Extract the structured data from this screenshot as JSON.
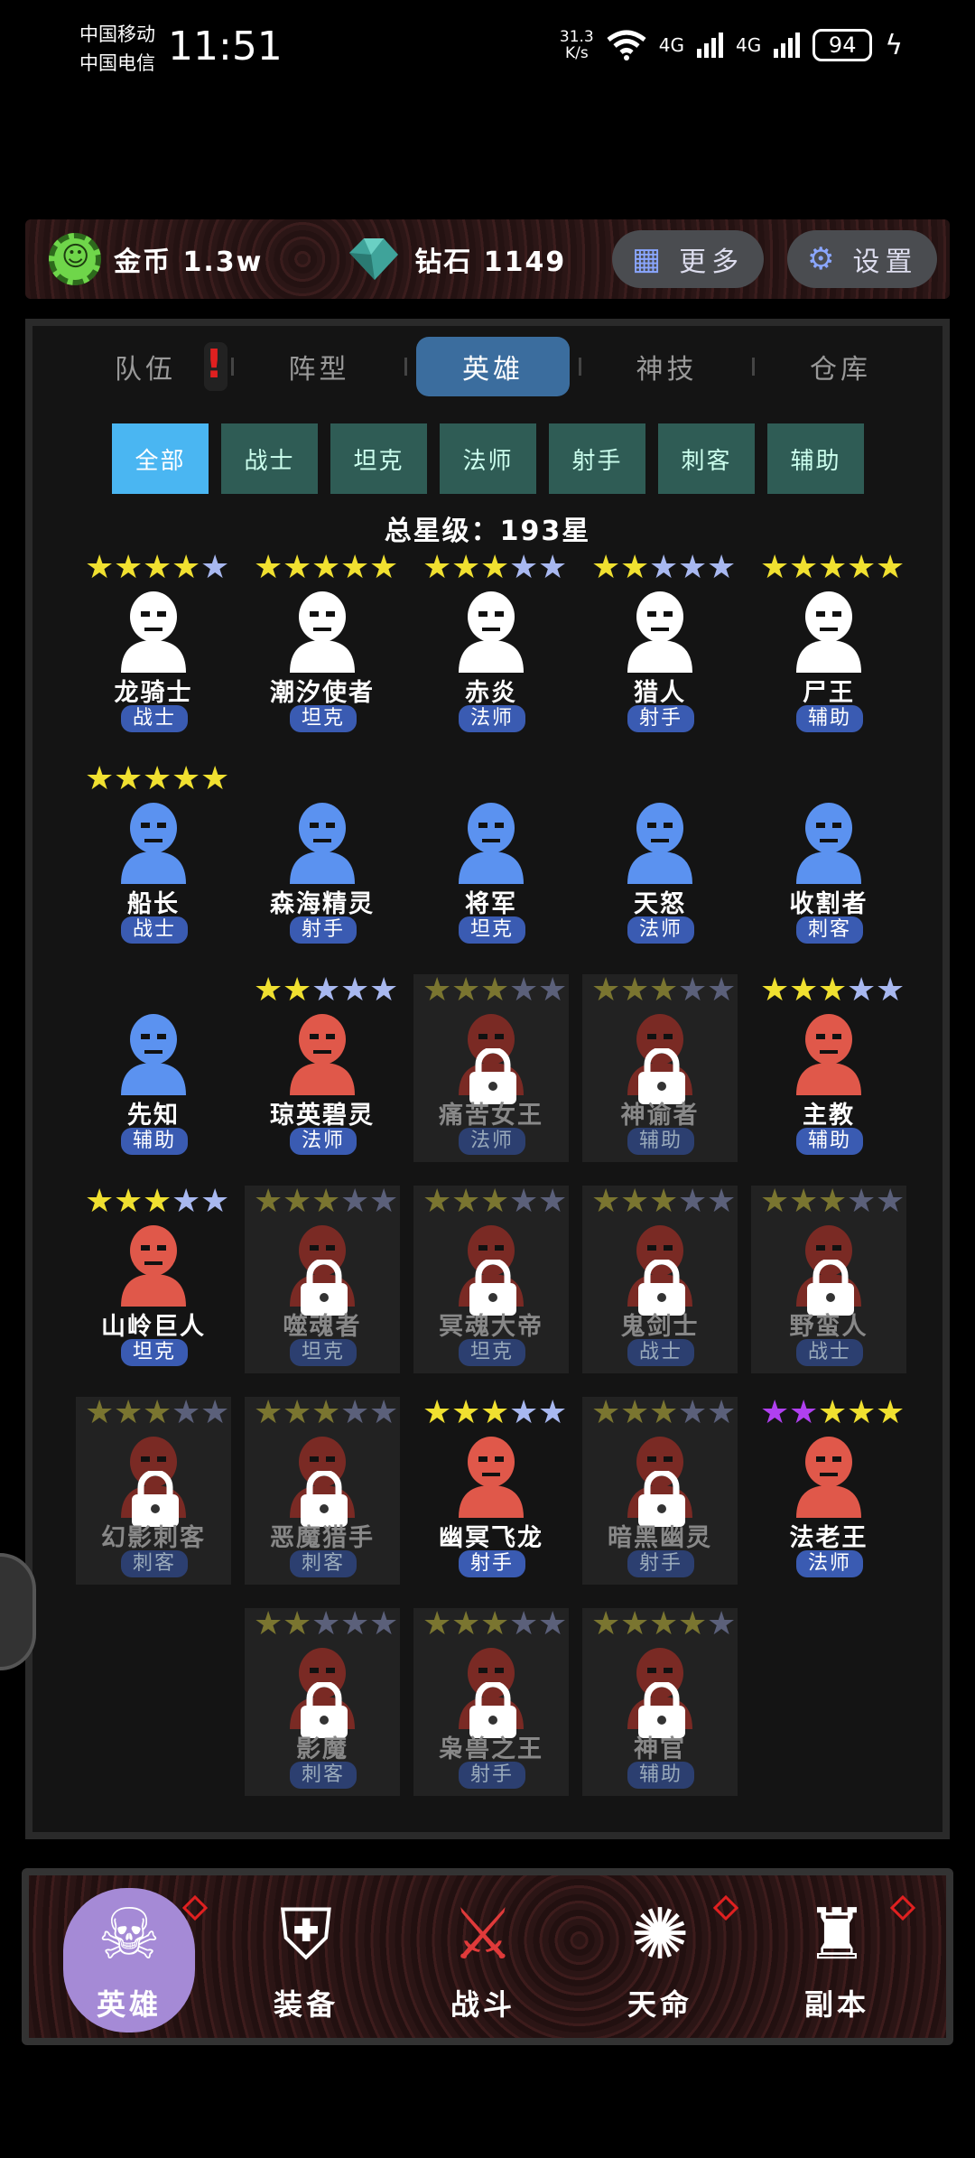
{
  "status": {
    "carrier1": "中国移动",
    "carrier2": "中国电信",
    "time": "11:51",
    "speed_top": "31.3",
    "speed_bottom": "K/s",
    "net1": "4G",
    "net2": "4G",
    "battery": "94"
  },
  "top": {
    "gold_label": "金币 1.3w",
    "diamond_label": "钻石 1149",
    "more": "更多",
    "settings": "设置"
  },
  "tabs": [
    "队伍",
    "阵型",
    "英雄",
    "神技",
    "仓库"
  ],
  "tab_alert": "!",
  "filters": [
    "全部",
    "战士",
    "坦克",
    "法师",
    "射手",
    "刺客",
    "辅助"
  ],
  "total": "总星级：193星",
  "heroes": [
    {
      "name": "龙骑士",
      "role": "战士",
      "stars": 4,
      "max": 5,
      "locked": false,
      "icon": "viking-helmet",
      "color": "#ffffff"
    },
    {
      "name": "潮汐使者",
      "role": "坦克",
      "stars": 5,
      "max": 5,
      "locked": false,
      "icon": "knight",
      "color": "#ffffff"
    },
    {
      "name": "赤炎",
      "role": "法师",
      "stars": 3,
      "max": 5,
      "locked": false,
      "icon": "demon-mask",
      "color": "#ffffff"
    },
    {
      "name": "猎人",
      "role": "射手",
      "stars": 2,
      "max": 5,
      "locked": false,
      "icon": "old-hunter",
      "color": "#ffffff"
    },
    {
      "name": "尸王",
      "role": "辅助",
      "stars": 5,
      "max": 5,
      "locked": false,
      "icon": "zombie",
      "color": "#ffffff"
    },
    {
      "name": "船长",
      "role": "战士",
      "stars": 5,
      "max": 5,
      "locked": false,
      "icon": "pirate",
      "color": "#5b92f0"
    },
    {
      "name": "森海精灵",
      "role": "射手",
      "stars": 0,
      "max": 0,
      "locked": false,
      "icon": "elf",
      "color": "#5b92f0"
    },
    {
      "name": "将军",
      "role": "坦克",
      "stars": 0,
      "max": 0,
      "locked": false,
      "icon": "helmet",
      "color": "#5b92f0"
    },
    {
      "name": "天怒",
      "role": "法师",
      "stars": 0,
      "max": 0,
      "locked": false,
      "icon": "druid",
      "color": "#5b92f0"
    },
    {
      "name": "收割者",
      "role": "刺客",
      "stars": 0,
      "max": 0,
      "locked": false,
      "icon": "reaper",
      "color": "#5b92f0"
    },
    {
      "name": "先知",
      "role": "辅助",
      "stars": 0,
      "max": 0,
      "locked": false,
      "icon": "prophet",
      "color": "#5b92f0"
    },
    {
      "name": "琼英碧灵",
      "role": "法师",
      "stars": 2,
      "max": 5,
      "locked": false,
      "icon": "voodoo",
      "color": "#e0584a"
    },
    {
      "name": "痛苦女王",
      "role": "法师",
      "stars": 3,
      "max": 5,
      "locked": true,
      "icon": "queen",
      "color": "#7a2a24"
    },
    {
      "name": "神谕者",
      "role": "辅助",
      "stars": 3,
      "max": 5,
      "locked": true,
      "icon": "oracle",
      "color": "#7a2a24"
    },
    {
      "name": "主教",
      "role": "辅助",
      "stars": 3,
      "max": 5,
      "locked": false,
      "icon": "bishop",
      "color": "#e0584a"
    },
    {
      "name": "山岭巨人",
      "role": "坦克",
      "stars": 3,
      "max": 5,
      "locked": false,
      "icon": "giant",
      "color": "#e0584a"
    },
    {
      "name": "噬魂者",
      "role": "坦克",
      "stars": 3,
      "max": 5,
      "locked": true,
      "icon": "tribal",
      "color": "#7a2a24"
    },
    {
      "name": "冥魂大帝",
      "role": "坦克",
      "stars": 3,
      "max": 5,
      "locked": true,
      "icon": "emperor",
      "color": "#7a2a24"
    },
    {
      "name": "鬼剑士",
      "role": "战士",
      "stars": 3,
      "max": 5,
      "locked": true,
      "icon": "swordsman",
      "color": "#7a2a24"
    },
    {
      "name": "野蛮人",
      "role": "战士",
      "stars": 3,
      "max": 5,
      "locked": true,
      "icon": "barbarian",
      "color": "#7a2a24"
    },
    {
      "name": "幻影刺客",
      "role": "刺客",
      "stars": 3,
      "max": 5,
      "locked": true,
      "icon": "phantom",
      "color": "#7a2a24"
    },
    {
      "name": "恶魔猎手",
      "role": "刺客",
      "stars": 3,
      "max": 5,
      "locked": true,
      "icon": "demon-hunter",
      "color": "#7a2a24"
    },
    {
      "name": "幽冥飞龙",
      "role": "射手",
      "stars": 3,
      "max": 5,
      "locked": false,
      "icon": "dragon",
      "color": "#e0584a"
    },
    {
      "name": "暗黑幽灵",
      "role": "射手",
      "stars": 3,
      "max": 5,
      "locked": true,
      "icon": "ghost",
      "color": "#7a2a24"
    },
    {
      "name": "法老王",
      "role": "法师",
      "stars": 5,
      "max": 5,
      "purple": 2,
      "locked": false,
      "icon": "pharaoh",
      "color": "#e0584a"
    },
    {
      "name": "影魔",
      "role": "刺客",
      "stars": 2,
      "max": 5,
      "locked": true,
      "icon": "shadow",
      "color": "#7a2a24"
    },
    {
      "name": "枭兽之王",
      "role": "射手",
      "stars": 3,
      "max": 5,
      "locked": true,
      "icon": "owl-king",
      "color": "#7a2a24"
    },
    {
      "name": "神官",
      "role": "辅助",
      "stars": 4,
      "max": 5,
      "locked": true,
      "icon": "priest",
      "color": "#7a2a24"
    }
  ],
  "nav": [
    {
      "label": "英雄",
      "icon": "skull-icon",
      "badge": true,
      "active": true
    },
    {
      "label": "装备",
      "icon": "armor-icon",
      "badge": false,
      "active": false
    },
    {
      "label": "战斗",
      "icon": "crossed-swords-icon",
      "badge": false,
      "active": false
    },
    {
      "label": "天命",
      "icon": "fate-emblem-icon",
      "badge": true,
      "active": false
    },
    {
      "label": "副本",
      "icon": "castle-icon",
      "badge": true,
      "active": false
    }
  ],
  "colors": {
    "accent_tab": "#3b6d9e",
    "filter_active": "#4ab6f2",
    "filter": "#2f5c55",
    "star_gold": "#f0e030",
    "star_empty": "#a8b8f0",
    "star_purple": "#b040f0",
    "nav_active": "#a58ad6"
  }
}
